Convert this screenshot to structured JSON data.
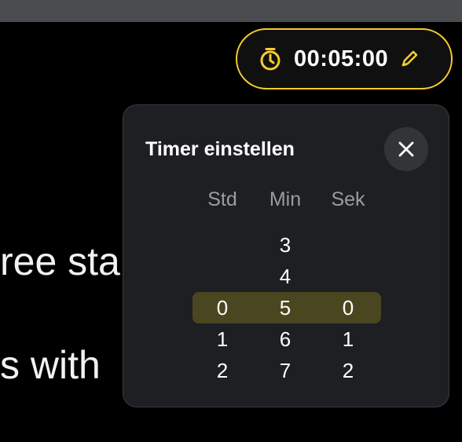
{
  "background": {
    "line_1": "ree sta",
    "line_2": "s with"
  },
  "timer": {
    "time": "00:05:00",
    "accent_color": "#f5cc2c",
    "icon_left": "stopwatch-icon",
    "icon_right": "pencil-icon"
  },
  "popup": {
    "title": "Timer einstellen",
    "close_icon": "close-icon",
    "columns": {
      "hours": {
        "header": "Std",
        "items": [
          "0",
          "1",
          "2"
        ],
        "selected": "0"
      },
      "minutes": {
        "header": "Min",
        "items": [
          "3",
          "4",
          "5",
          "6",
          "7"
        ],
        "selected": "5"
      },
      "seconds": {
        "header": "Sek",
        "items": [
          "0",
          "1",
          "2"
        ],
        "selected": "0"
      }
    }
  }
}
